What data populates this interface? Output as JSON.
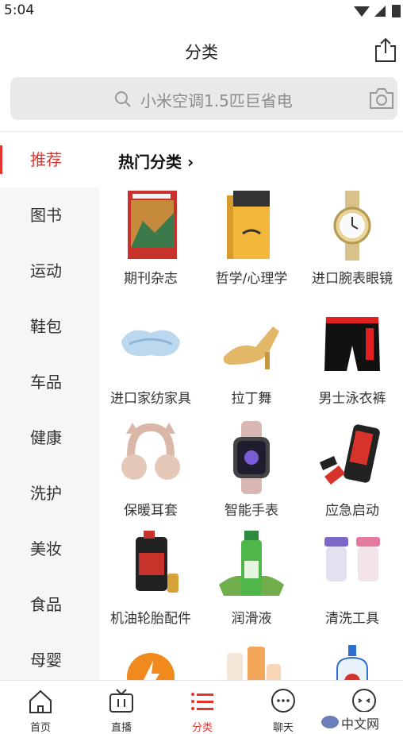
{
  "status": {
    "time": "5:04"
  },
  "header": {
    "title": "分类"
  },
  "search": {
    "placeholder": "小米空调1.5匹巨省电"
  },
  "sidebar": {
    "items": [
      {
        "label": "推荐"
      },
      {
        "label": "图书"
      },
      {
        "label": "运动"
      },
      {
        "label": "鞋包"
      },
      {
        "label": "车品"
      },
      {
        "label": "健康"
      },
      {
        "label": "洗护"
      },
      {
        "label": "美妆"
      },
      {
        "label": "食品"
      },
      {
        "label": "母婴"
      }
    ]
  },
  "content": {
    "section_title": "热门分类",
    "categories": [
      {
        "label": "期刊杂志"
      },
      {
        "label": "哲学/心理学"
      },
      {
        "label": "进口腕表眼镜"
      },
      {
        "label": "进口家纺家具"
      },
      {
        "label": "拉丁舞"
      },
      {
        "label": "男士泳衣裤"
      },
      {
        "label": "保暖耳套"
      },
      {
        "label": "智能手表"
      },
      {
        "label": "应急启动"
      },
      {
        "label": "机油轮胎配件"
      },
      {
        "label": "润滑液"
      },
      {
        "label": "清洗工具"
      }
    ]
  },
  "tabs": [
    {
      "label": "首页"
    },
    {
      "label": "直播"
    },
    {
      "label": "分类"
    },
    {
      "label": "聊天"
    },
    {
      "label": ""
    }
  ],
  "watermark": {
    "text": "中文网"
  },
  "colors": {
    "accent": "#e5332d",
    "sidebar_bg": "#f6f6f6",
    "search_bg": "#e9e9e9"
  }
}
